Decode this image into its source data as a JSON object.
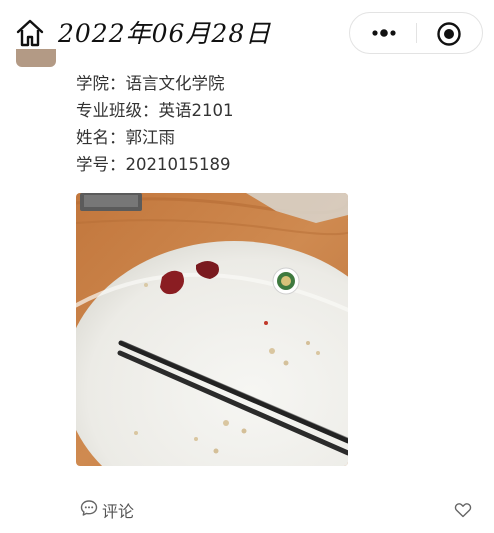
{
  "header": {
    "title": "2022年06月28日",
    "home_icon": "home-icon",
    "more_icon": "more-dots-icon",
    "close_icon": "target-close-icon"
  },
  "post": {
    "info_lines": [
      "学院：语言文化学院",
      "专业班级：英语2101",
      "姓名：郭江雨",
      "学号：2021015189"
    ],
    "photo_icon": "photo-image"
  },
  "footer": {
    "comment_label": "评论",
    "comment_icon": "comment-bubble-icon",
    "like_icon": "heart-icon"
  }
}
